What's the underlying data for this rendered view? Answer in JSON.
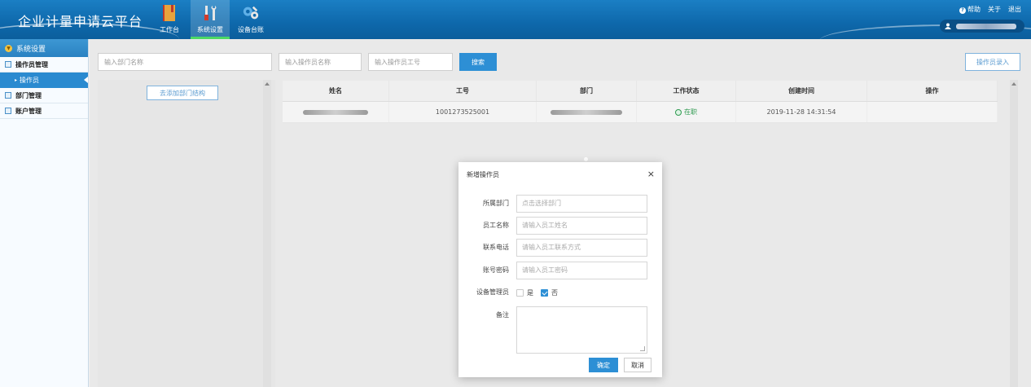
{
  "app": {
    "title": "企业计量申请云平台"
  },
  "nav": [
    {
      "label": "工作台",
      "icon": "book-icon"
    },
    {
      "label": "系统设置",
      "icon": "tools-icon",
      "active": true
    },
    {
      "label": "设备台账",
      "icon": "equipment-gears-icon"
    }
  ],
  "top_links": {
    "help": "帮助",
    "about": "关于",
    "logout": "退出"
  },
  "sidebar": {
    "header": "系统设置",
    "items": [
      {
        "label": "操作员管理"
      },
      {
        "label": "操作员",
        "sub": true,
        "active": true
      },
      {
        "label": "部门管理"
      },
      {
        "label": "账户管理"
      }
    ]
  },
  "filters": {
    "dept_name_placeholder": "输入部门名称",
    "operator_name_placeholder": "输入操作员名称",
    "operator_no_placeholder": "输入操作员工号",
    "search_label": "搜索",
    "add_operator_label": "操作员录入",
    "add_dept_structure_label": "去添加部门结构"
  },
  "table": {
    "columns": [
      "姓名",
      "工号",
      "部门",
      "工作状态",
      "创建时间",
      "操作"
    ],
    "rows": [
      {
        "name": "",
        "employee_no": "1001273525001",
        "department": "",
        "status": "在职",
        "created": "2019-11-28 14:31:54",
        "action": ""
      }
    ]
  },
  "modal": {
    "title": "新增操作员",
    "close": "×",
    "fields": [
      {
        "label": "所属部门",
        "placeholder": "点击选择部门"
      },
      {
        "label": "员工名称",
        "placeholder": "请输入员工姓名"
      },
      {
        "label": "联系电话",
        "placeholder": "请输入员工联系方式"
      },
      {
        "label": "账号密码",
        "placeholder": "请输入员工密码"
      }
    ],
    "device_admin": {
      "label": "设备管理员",
      "yes": "是",
      "no": "否",
      "selected": "否"
    },
    "remark_label": "备注",
    "ok_label": "确定",
    "cancel_label": "取消"
  },
  "colors": {
    "header": "#0e68ab",
    "accent": "#2d8fd5",
    "active_tab_underline": "#4cd964",
    "status_active": "#2e9a4f"
  }
}
